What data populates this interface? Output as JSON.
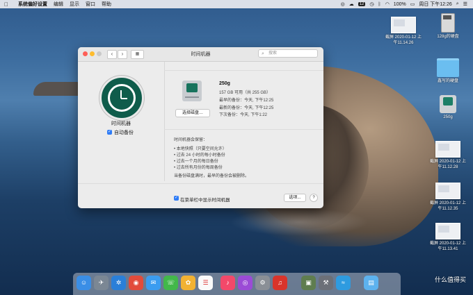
{
  "menubar": {
    "app_name": "系统偏好设置",
    "items": [
      "编辑",
      "显示",
      "窗口",
      "帮助"
    ],
    "clock": "周日 下午12:26",
    "battery": "100%",
    "badge": "12",
    "status_glyph": "◎"
  },
  "desktop_icons": [
    {
      "label": "截屏 2020-01-12 上\n午11.14.26",
      "kind": "screenshot"
    },
    {
      "label": "128g的硬盘",
      "kind": "sdcard"
    },
    {
      "label": "鑫写的硬盘",
      "kind": "folder"
    },
    {
      "label": "250g",
      "kind": "timemachine-disk"
    },
    {
      "label": "截屏 2020-01-12 上\n午11.12.28",
      "kind": "screenshot"
    },
    {
      "label": "截屏 2020-01-12 上\n午11.12.35",
      "kind": "screenshot"
    },
    {
      "label": "截屏 2020-01-12 上\n午11.13.41",
      "kind": "screenshot"
    }
  ],
  "window": {
    "title": "时间机器",
    "search_placeholder": "搜索",
    "app_label": "时间机器",
    "auto_backup_label": "自动备份",
    "auto_backup_checked": true,
    "disk": {
      "name": "250g",
      "available": "157 GB 可用（共 255 GB）",
      "oldest": "最早的备份：今天, 下午12:25",
      "latest": "最新的备份：今天, 下午12:25",
      "next": "下次备份：今天, 下午1:22"
    },
    "select_disk_button": "选择磁盘…",
    "keep_title": "时间机器会保留：",
    "keep_items": [
      "• 本地快照（只要空间允许）",
      "• 过去 24 小时的每小时备份",
      "• 过去一个月的每日备份",
      "• 过去所有月份的每周备份"
    ],
    "keep_note": "当备份磁盘满时，最早的备份会被删除。",
    "show_in_menubar_label": "在菜单栏中显示时间机器",
    "show_in_menubar_checked": true,
    "options_button": "选项...",
    "help_button": "?"
  },
  "dock": {
    "apps": [
      "finder",
      "launchpad",
      "safari",
      "chrome",
      "messages",
      "wechat",
      "photos",
      "reminders",
      "music",
      "podcasts",
      "system-preferences",
      "netease-music",
      "preview",
      "instruments",
      "vscode-like",
      "downloads-folder"
    ]
  },
  "watermark": "什么值得买",
  "colors": {
    "accent": "#2f7cf6",
    "time_machine_green": "#0f5c4b"
  }
}
